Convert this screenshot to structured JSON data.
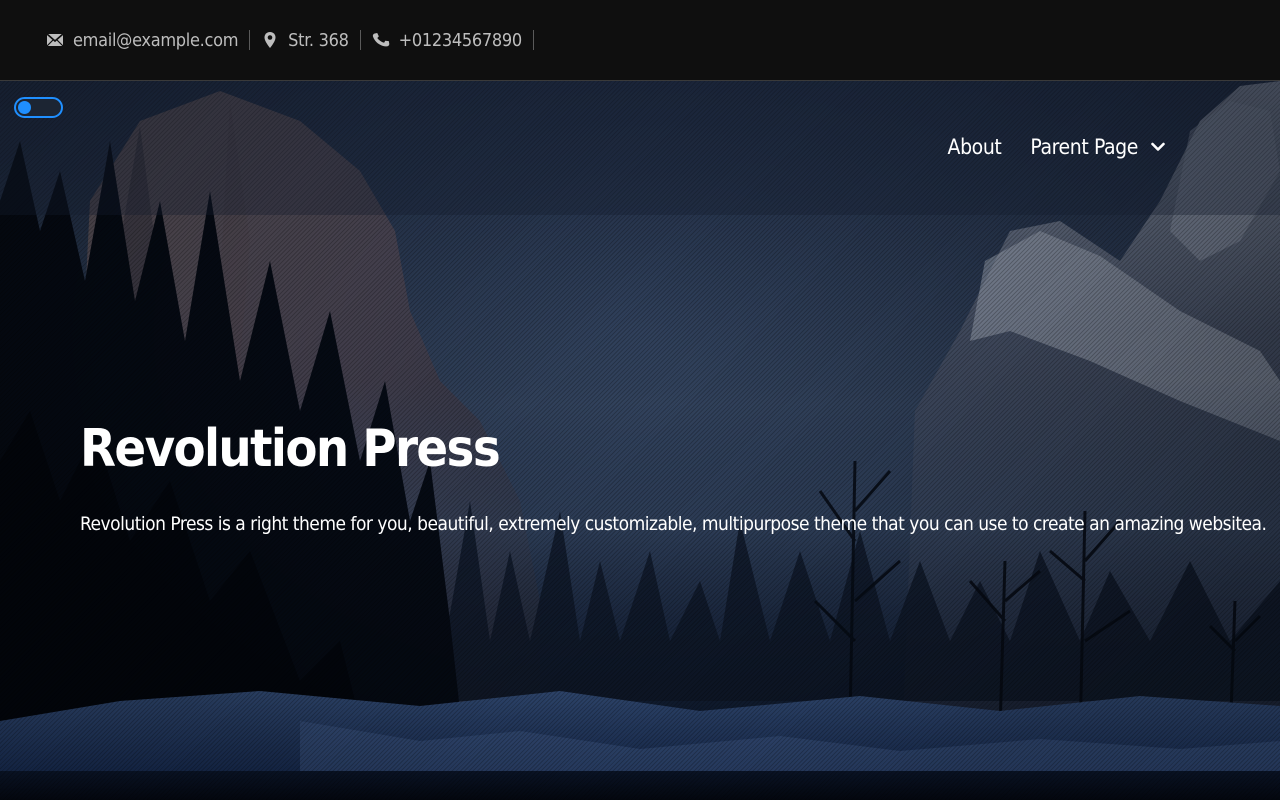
{
  "topbar": {
    "contacts": [
      {
        "icon": "envelope-icon",
        "text": "email@example.com"
      },
      {
        "icon": "map-pin-icon",
        "text": "Str. 368"
      },
      {
        "icon": "phone-icon",
        "text": "+01234567890"
      }
    ]
  },
  "header": {
    "theme_toggle": {
      "state": "off"
    },
    "nav": {
      "items": [
        {
          "label": "About"
        },
        {
          "label": "Parent Page",
          "has_submenu": true
        }
      ]
    }
  },
  "hero": {
    "title": "Revolution Press",
    "description": "Revolution Press is a right theme for you, beautiful, extremely customizable, multipurpose theme that you can use to create an amazing websitea."
  },
  "colors": {
    "topbar_bg": "#0f0f0f",
    "accent": "#1f8fff",
    "text_light": "#ffffff",
    "text_muted": "#bdbdbd"
  }
}
